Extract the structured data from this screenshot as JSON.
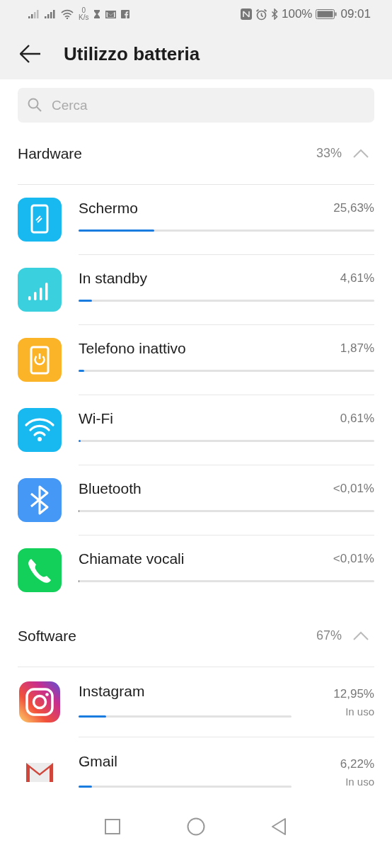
{
  "status_bar": {
    "speed_value": "0",
    "speed_unit": "K/s",
    "battery": "100%",
    "time": "09:01"
  },
  "app_bar": {
    "title": "Utilizzo batteria"
  },
  "search": {
    "placeholder": "Cerca"
  },
  "sections": [
    {
      "title": "Hardware",
      "total": "33%",
      "expanded": true,
      "items": [
        {
          "kind": "hardware",
          "name": "Schermo",
          "reading": "25,63%",
          "level": 0.2563
        },
        {
          "kind": "hardware",
          "name": "In standby",
          "reading": "4,61%",
          "level": 0.0461
        },
        {
          "kind": "hardware",
          "name": "Telefono inattivo",
          "reading": "1,87%",
          "level": 0.0187
        },
        {
          "kind": "hardware",
          "name": "Wi-Fi",
          "reading": "0,61%",
          "level": 0.0061
        },
        {
          "kind": "hardware",
          "name": "Bluetooth",
          "reading": "<0,01%",
          "level": 0.001
        },
        {
          "kind": "hardware",
          "name": "Chiamate vocali",
          "reading": "<0,01%",
          "level": 0.001
        }
      ]
    },
    {
      "title": "Software",
      "total": "67%",
      "expanded": true,
      "items": [
        {
          "kind": "app",
          "name": "Instagram",
          "reading": "12,95%",
          "status": "In uso",
          "level": 0.13
        },
        {
          "kind": "app",
          "name": "Gmail",
          "reading": "6,22%",
          "status": "In uso",
          "level": 0.063
        }
      ]
    }
  ]
}
